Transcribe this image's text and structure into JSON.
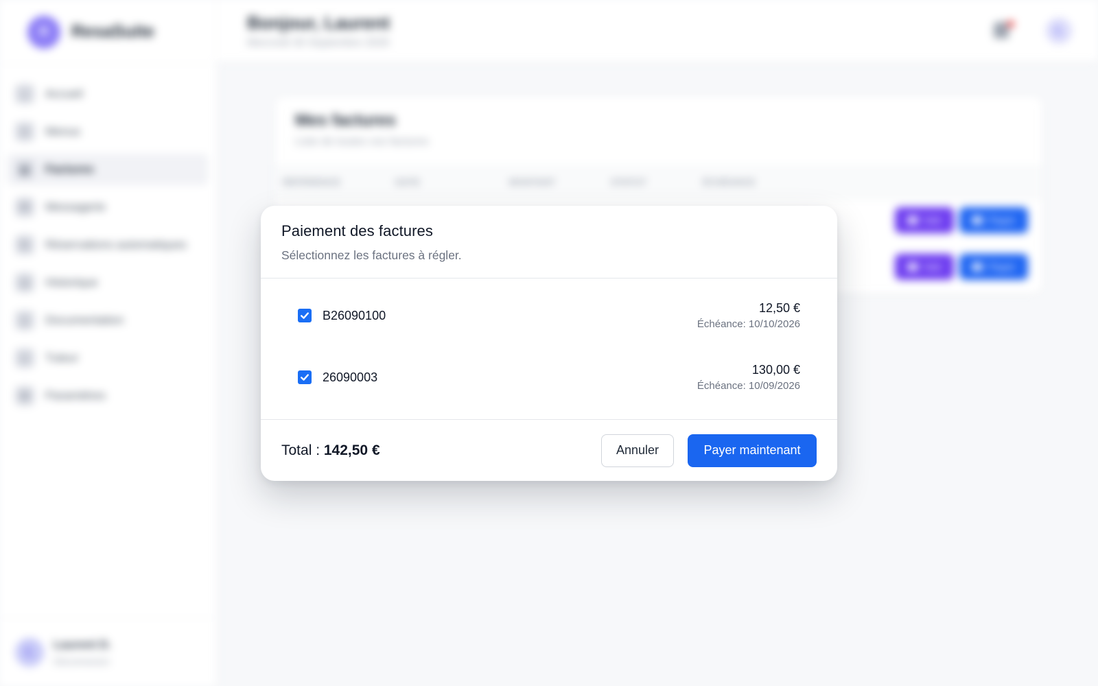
{
  "app": {
    "brand_initial": "R",
    "brand_name": "ResaSuite"
  },
  "sidebar": {
    "items": [
      {
        "label": "Accueil",
        "icon": "home-icon"
      },
      {
        "label": "Menus",
        "icon": "menu-icon"
      },
      {
        "label": "Factures",
        "icon": "invoice-icon",
        "active": true
      },
      {
        "label": "Messagerie",
        "icon": "mail-icon"
      },
      {
        "label": "Réservations automatiques",
        "icon": "refresh-icon"
      },
      {
        "label": "Historique",
        "icon": "clock-icon"
      },
      {
        "label": "Documentation",
        "icon": "document-icon"
      },
      {
        "label": "Tuteur",
        "icon": "user-icon"
      },
      {
        "label": "Paramètres",
        "icon": "gear-icon"
      }
    ],
    "user": {
      "initial": "L",
      "name": "Laurent D.",
      "action": "Déconnexion"
    }
  },
  "header": {
    "greeting": "Bonjour, Laurent",
    "date": "Mercredi 30 Septembre 2026",
    "avatar_initial": "L"
  },
  "invoices_card": {
    "title": "Mes factures",
    "subtitle": "Liste de toutes vos factures",
    "columns": [
      "RÉFÉRENCE",
      "DATE",
      "MONTANT",
      "STATUT",
      "ÉCHÉANCE"
    ],
    "view_label": "Voir",
    "pay_label": "Payer"
  },
  "modal": {
    "title": "Paiement des factures",
    "subtitle": "Sélectionnez les factures à régler.",
    "invoices": [
      {
        "ref": "B26090100",
        "amount": "12,50 €",
        "due": "Échéance: 10/10/2026",
        "checked": true
      },
      {
        "ref": "26090003",
        "amount": "130,00 €",
        "due": "Échéance: 10/09/2026",
        "checked": true
      }
    ],
    "total_label": "Total :",
    "total_value": "142,50 €",
    "cancel_label": "Annuler",
    "pay_label": "Payer maintenant"
  },
  "colors": {
    "primary": "#1a66f0",
    "violet": "#6d3cf0",
    "checkbox": "#1a6ef5"
  }
}
